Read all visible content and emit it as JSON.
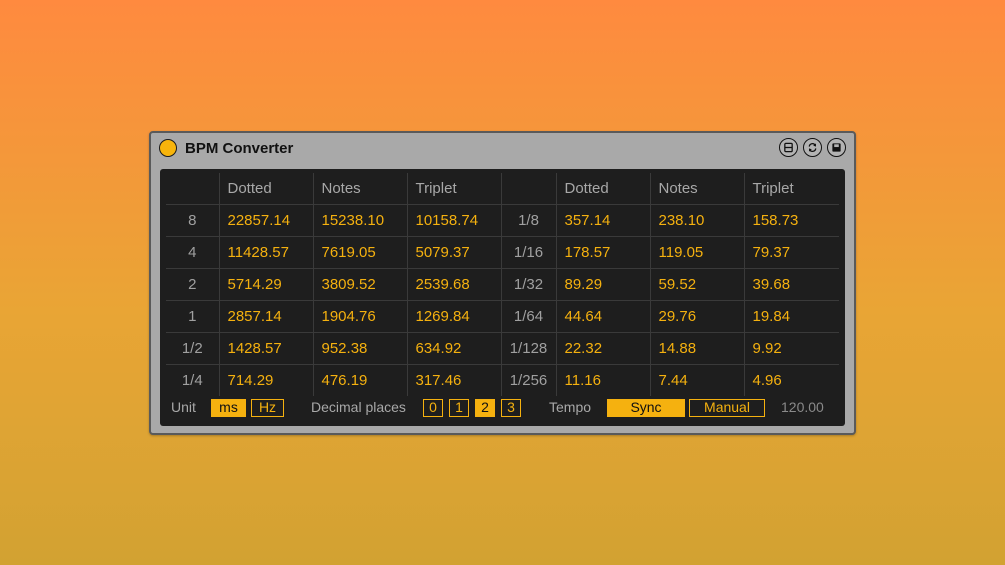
{
  "device": {
    "title": "BPM Converter",
    "controls": [
      "fit-icon",
      "hot-swap-icon",
      "save-preset-icon"
    ]
  },
  "table": {
    "headers": [
      "",
      "Dotted",
      "Notes",
      "Triplet",
      "",
      "Dotted",
      "Notes",
      "Triplet"
    ],
    "rows": [
      [
        "8",
        "22857.14",
        "15238.10",
        "10158.74",
        "1/8",
        "357.14",
        "238.10",
        "158.73"
      ],
      [
        "4",
        "11428.57",
        "7619.05",
        "5079.37",
        "1/16",
        "178.57",
        "119.05",
        "79.37"
      ],
      [
        "2",
        "5714.29",
        "3809.52",
        "2539.68",
        "1/32",
        "89.29",
        "59.52",
        "39.68"
      ],
      [
        "1",
        "2857.14",
        "1904.76",
        "1269.84",
        "1/64",
        "44.64",
        "29.76",
        "19.84"
      ],
      [
        "1/2",
        "1428.57",
        "952.38",
        "634.92",
        "1/128",
        "22.32",
        "14.88",
        "9.92"
      ],
      [
        "1/4",
        "714.29",
        "476.19",
        "317.46",
        "1/256",
        "11.16",
        "7.44",
        "4.96"
      ]
    ]
  },
  "controls": {
    "unit_label": "Unit",
    "unit_options": [
      "ms",
      "Hz"
    ],
    "unit_selected": "ms",
    "decimal_label": "Decimal places",
    "decimal_options": [
      "0",
      "1",
      "2",
      "3"
    ],
    "decimal_selected": "2",
    "tempo_label": "Tempo",
    "tempo_modes": [
      "Sync",
      "Manual"
    ],
    "tempo_mode_selected": "Sync",
    "tempo_value": "120.00"
  },
  "colors": {
    "accent": "#f5b10f",
    "panel_bg": "#1e1e1e",
    "device_bg": "#a9a9a9",
    "grid_line": "#3a3a3a"
  }
}
